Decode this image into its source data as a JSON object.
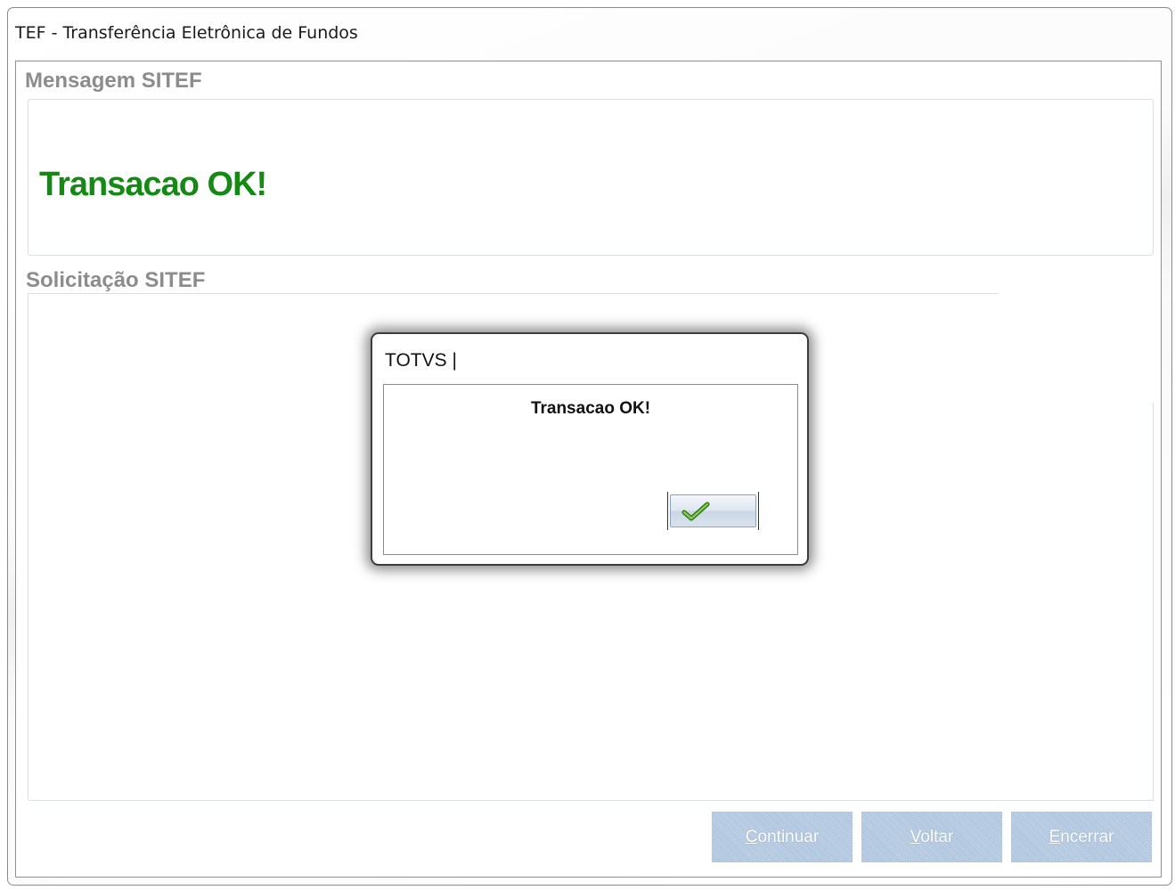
{
  "window": {
    "title": "TEF - Transferência Eletrônica de Fundos"
  },
  "mensagem": {
    "label": "Mensagem SITEF",
    "text": "Transacao OK!",
    "text_color": "#148a14"
  },
  "solicitacao": {
    "label": "Solicitação SITEF"
  },
  "buttons": {
    "continuar": {
      "first": "C",
      "rest": "ontinuar"
    },
    "voltar": {
      "first": "V",
      "rest": "oltar"
    },
    "encerrar": {
      "first": "E",
      "rest": "ncerrar"
    }
  },
  "dialog": {
    "title": "TOTVS |",
    "message": "Transacao OK!",
    "ok_icon": "checkmark-icon"
  }
}
